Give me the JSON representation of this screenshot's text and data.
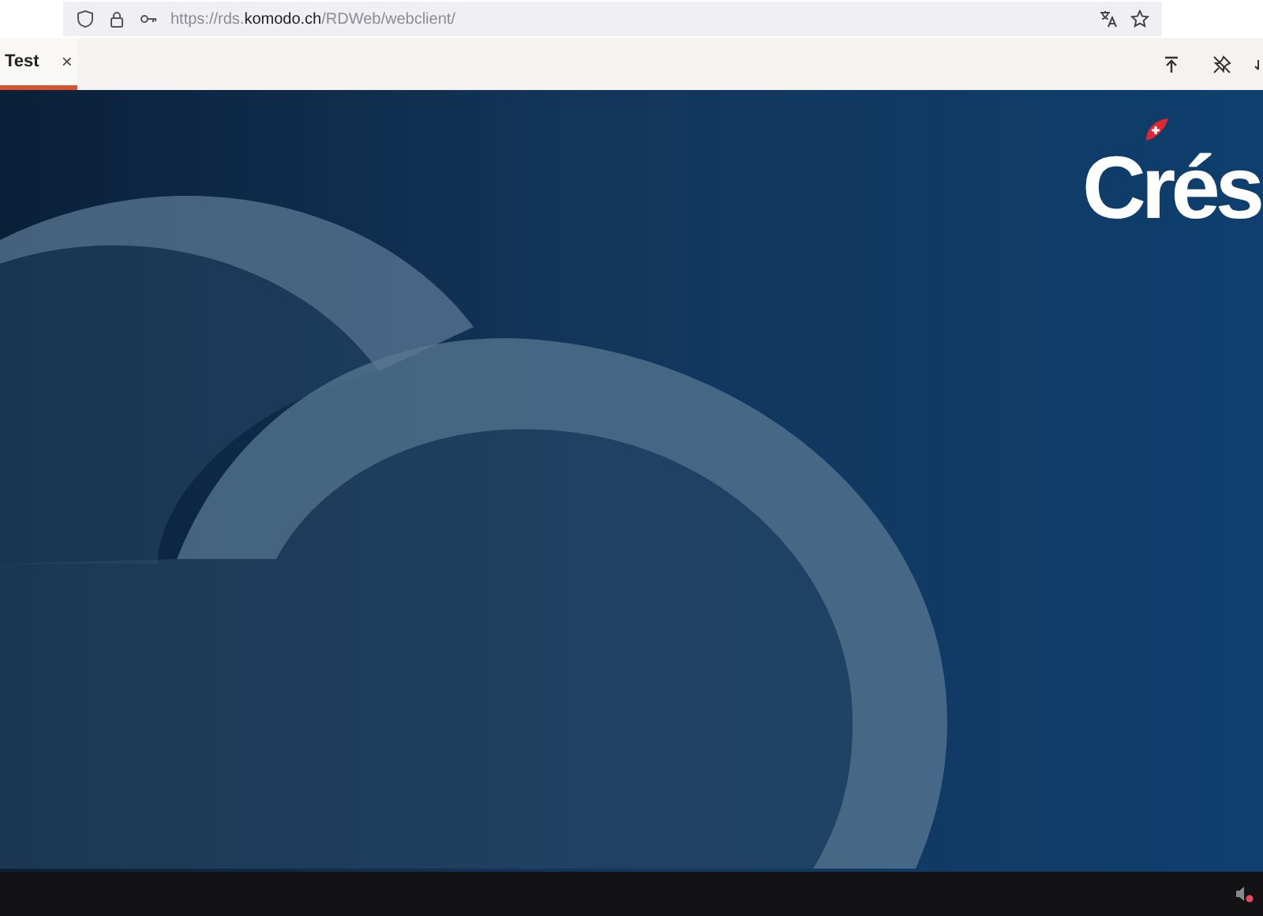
{
  "address_bar": {
    "url": "https://rds.**komodo.ch**/RDWeb/webclient/"
  },
  "tabs": [
    {
      "label": "Test",
      "close": "×",
      "selected": true
    }
  ],
  "desktop": {
    "logo": "Crés"
  }
}
